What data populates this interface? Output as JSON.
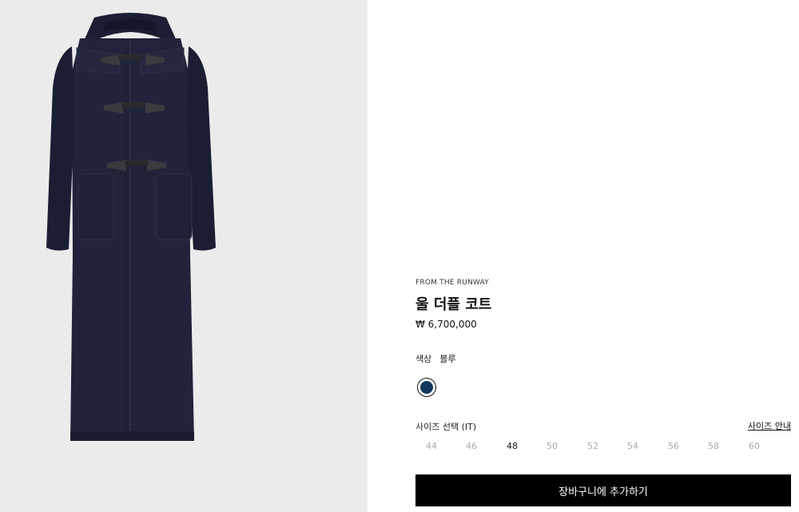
{
  "product": {
    "eyebrow": "FROM THE RUNWAY",
    "name": "울 더플 코트",
    "price": "₩ 6,700,000",
    "image_alt": "navy wool duffle coat"
  },
  "color": {
    "label": "색상",
    "value": "블루",
    "swatches": [
      {
        "name": "블루",
        "hex": "#13385f",
        "selected": true
      }
    ]
  },
  "size_selector": {
    "label": "사이즈 선택 (IT)",
    "guide_label": "사이즈 안내",
    "sizes": [
      "44",
      "46",
      "48",
      "50",
      "52",
      "54",
      "56",
      "58",
      "60"
    ],
    "selected": "48"
  },
  "cart": {
    "add_label": "장바구니에 추가하기"
  },
  "colors": {
    "coat": "#20233a",
    "coat_dark": "#161829",
    "image_background": "#ebebeb",
    "button": "#000000",
    "swatch_blue": "#13385f"
  }
}
